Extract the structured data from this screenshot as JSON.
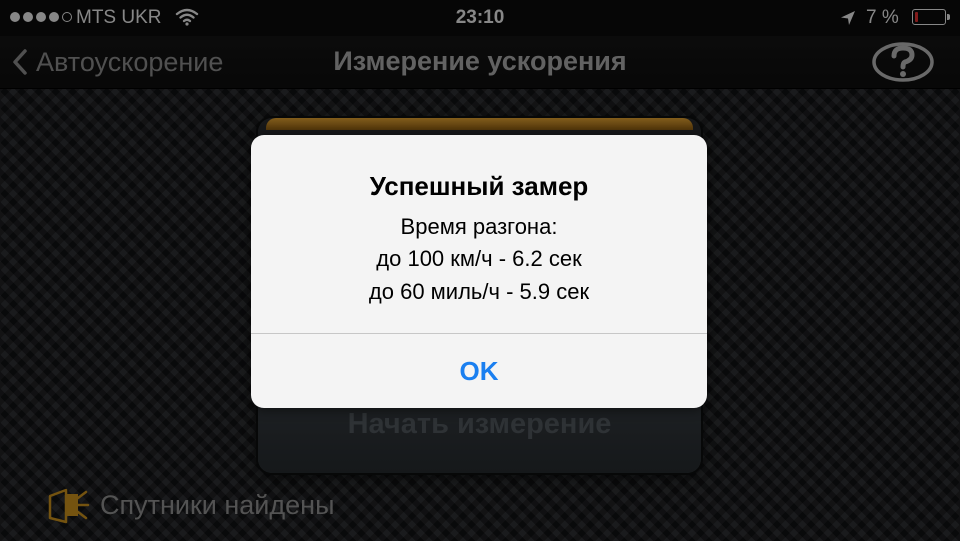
{
  "status_bar": {
    "signal_strength": "4 of 5",
    "carrier": "MTS UKR",
    "time": "23:10",
    "battery_percent": "7 %",
    "battery_level": 0.07,
    "icons": [
      "signal-dots-icon",
      "wifi-icon",
      "location-arrow-icon",
      "battery-icon"
    ]
  },
  "nav": {
    "back_label": "Автоускорение",
    "title": "Измерение ускорения",
    "help_icon": "question-mark-icon"
  },
  "panel": {
    "start_label": "Начать измерение",
    "accent_color": "#e0a030"
  },
  "gps": {
    "status_text": "Спутники найдены",
    "icon": "satellite-icon",
    "icon_color": "#c8901c"
  },
  "alert": {
    "title": "Успешный замер",
    "lines": [
      "Время разгона:",
      "до 100 км/ч - 6.2 сек",
      "до 60 миль/ч - 5.9 сек"
    ],
    "ok_label": "OK",
    "ok_color": "#1a7ff0"
  }
}
